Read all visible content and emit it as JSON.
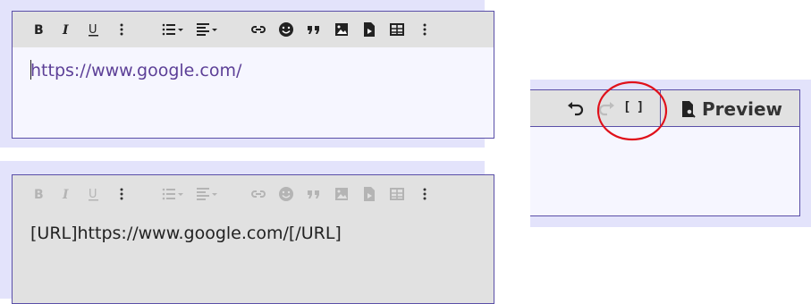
{
  "editor_top": {
    "content": "https://www.google.com/",
    "toolbar_icons": [
      "bold-icon",
      "italic-icon",
      "underline-icon",
      "more-vertical-icon",
      "list-icon",
      "align-icon",
      "link-icon",
      "smile-icon",
      "quote-icon",
      "image-icon",
      "media-icon",
      "table-icon",
      "more-vertical-icon"
    ]
  },
  "editor_bottom": {
    "content": "[URL]https://www.google.com/[/URL]",
    "mode": "bbcode"
  },
  "toolbar_zoom": {
    "undo_icon": "undo-icon",
    "redo_icon": "redo-icon",
    "toggle_bbcode_label": "[ ]",
    "preview_label": "Preview",
    "preview_icon": "file-search-icon"
  },
  "colors": {
    "frame": "#5a4fa8",
    "panel": "#e3e3fb",
    "link_text": "#5c3f97",
    "highlight_circle": "#e0101a"
  }
}
